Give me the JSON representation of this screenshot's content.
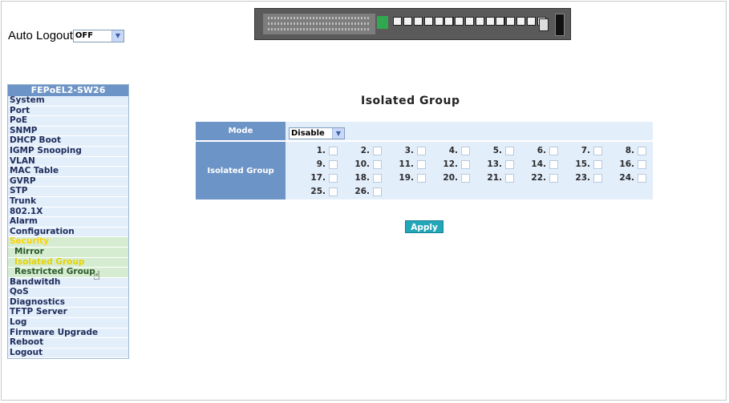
{
  "auto_logout": {
    "label": "Auto Logout",
    "value": "OFF"
  },
  "sidebar": {
    "title": "FEPoEL2-SW26",
    "items": [
      {
        "label": "System"
      },
      {
        "label": "Port"
      },
      {
        "label": "PoE"
      },
      {
        "label": "SNMP"
      },
      {
        "label": "DHCP Boot"
      },
      {
        "label": "IGMP Snooping"
      },
      {
        "label": "VLAN"
      },
      {
        "label": "MAC Table"
      },
      {
        "label": "GVRP"
      },
      {
        "label": "STP"
      },
      {
        "label": "Trunk"
      },
      {
        "label": "802.1X"
      },
      {
        "label": "Alarm"
      },
      {
        "label": "Configuration"
      },
      {
        "label": "Security"
      },
      {
        "label": "Mirror"
      },
      {
        "label": "Isolated Group"
      },
      {
        "label": "Restricted Group"
      },
      {
        "label": "Bandwitdh"
      },
      {
        "label": "QoS"
      },
      {
        "label": "Diagnostics"
      },
      {
        "label": "TFTP Server"
      },
      {
        "label": "Log"
      },
      {
        "label": "Firmware Upgrade"
      },
      {
        "label": "Reboot"
      },
      {
        "label": "Logout"
      }
    ]
  },
  "main": {
    "title": "Isolated Group",
    "mode_label": "Mode",
    "mode_value": "Disable",
    "group_label": "Isolated Group",
    "ports": [
      "1.",
      "2.",
      "3.",
      "4.",
      "5.",
      "6.",
      "7.",
      "8.",
      "9.",
      "10.",
      "11.",
      "12.",
      "13.",
      "14.",
      "15.",
      "16.",
      "17.",
      "18.",
      "19.",
      "20.",
      "21.",
      "22.",
      "23.",
      "24.",
      "25.",
      "26."
    ],
    "apply_label": "Apply"
  },
  "colors": {
    "header_blue": "#6d94c6",
    "cell_bg": "#e3eefb",
    "apply_teal": "#22a6b8",
    "security_yellow": "#ffd200"
  }
}
